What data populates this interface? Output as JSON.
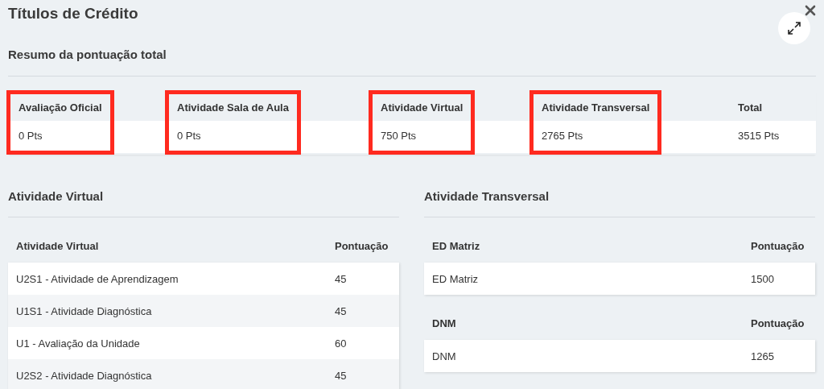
{
  "title": "Títulos de Crédito",
  "summary": {
    "heading": "Resumo da pontuação total",
    "columns": [
      {
        "label": "Avaliação Oficial",
        "value": "0 Pts",
        "highlighted": true
      },
      {
        "label": "Atividade Sala de Aula",
        "value": "0 Pts",
        "highlighted": true
      },
      {
        "label": "Atividade Virtual",
        "value": "750 Pts",
        "highlighted": true
      },
      {
        "label": "Atividade Transversal",
        "value": "2765 Pts",
        "highlighted": true
      },
      {
        "label": "Total",
        "value": "3515 Pts",
        "highlighted": false
      }
    ]
  },
  "sections": [
    {
      "heading": "Atividade Virtual",
      "tables": [
        {
          "columns": [
            "Atividade Virtual",
            "Pontuação"
          ],
          "rows": [
            [
              "U2S1 - Atividade de Aprendizagem",
              "45"
            ],
            [
              "U1S1 - Atividade Diagnóstica",
              "45"
            ],
            [
              "U1 - Avaliação da Unidade",
              "60"
            ],
            [
              "U2S2 - Atividade Diagnóstica",
              "45"
            ]
          ]
        }
      ]
    },
    {
      "heading": "Atividade Transversal",
      "tables": [
        {
          "columns": [
            "ED Matriz",
            "Pontuação"
          ],
          "rows": [
            [
              "ED Matriz",
              "1500"
            ]
          ]
        },
        {
          "columns": [
            "DNM",
            "Pontuação"
          ],
          "rows": [
            [
              "DNM",
              "1265"
            ]
          ]
        }
      ]
    }
  ]
}
